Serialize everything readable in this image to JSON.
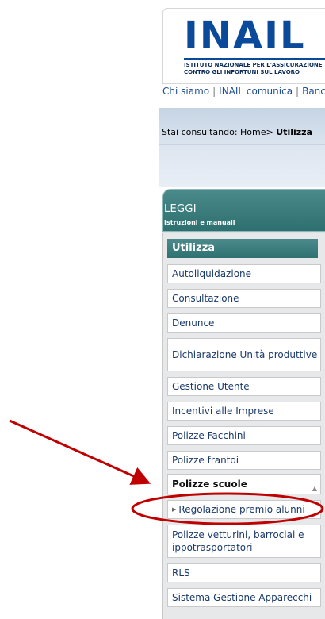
{
  "header": {
    "logo_text": "INAIL",
    "logo_sub_line1": "ISTITUTO NAZIONALE PER L'ASSICURAZIONE",
    "logo_sub_line2": "CONTRO GLI INFORTUNI SUL LAVORO"
  },
  "topnav": [
    "Chi siamo",
    "INAIL comunica",
    "Banc"
  ],
  "breadcrumb": {
    "prefix": "Stai consultando: Home> ",
    "current": "Utilizza"
  },
  "section": {
    "title": "LEGGI",
    "subtitle": "Istruzioni e manuali"
  },
  "menu": {
    "header": "Utilizza",
    "items": [
      {
        "label": "Autoliquidazione"
      },
      {
        "label": "Consultazione"
      },
      {
        "label": "Denunce"
      },
      {
        "label": "Dichiarazione Unità produttive"
      },
      {
        "label": "Gestione Utente"
      },
      {
        "label": "Incentivi alle Imprese"
      },
      {
        "label": "Polizze Facchini"
      },
      {
        "label": "Polizze frantoi"
      },
      {
        "label": "Polizze scuole"
      },
      {
        "label": "Regolazione premio alunni"
      },
      {
        "label": "Polizze vetturini, barrociai e ippotrasportatori"
      },
      {
        "label": "RLS"
      },
      {
        "label": "Sistema Gestione Apparecchi"
      }
    ]
  },
  "colors": {
    "brand_blue": "#0b4a9a",
    "teal": "#2e6f6f",
    "annotation_red": "#c00000"
  }
}
